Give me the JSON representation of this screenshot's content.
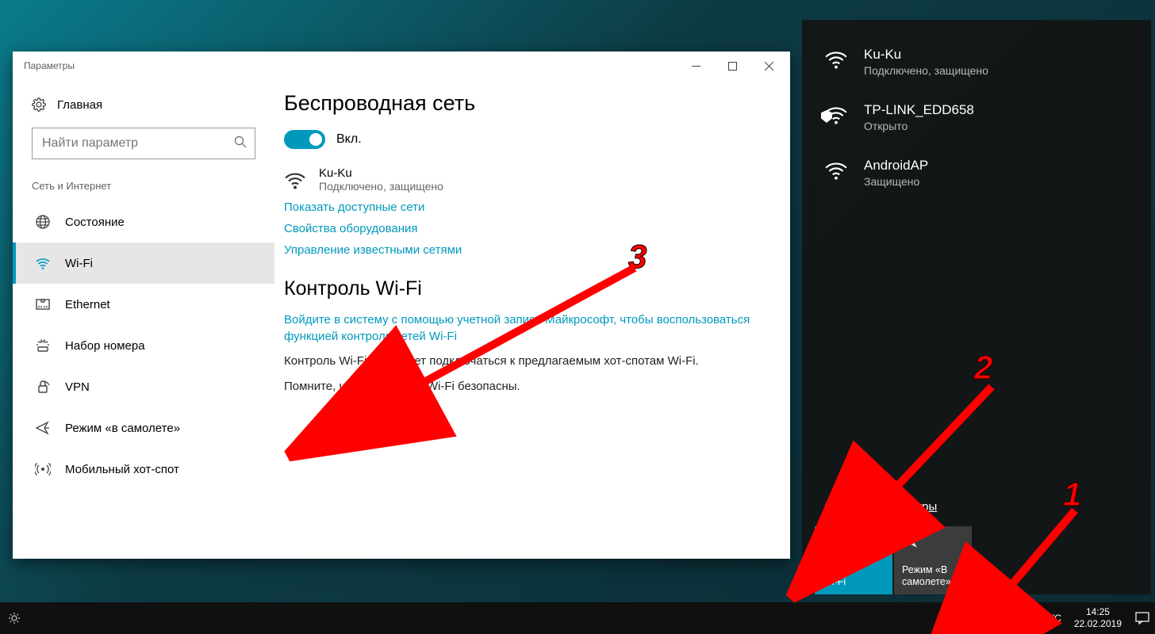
{
  "settings": {
    "title": "Параметры",
    "home": "Главная",
    "search_placeholder": "Найти параметр",
    "section": "Сеть и Интернет",
    "nav": [
      {
        "key": "status",
        "label": "Состояние"
      },
      {
        "key": "wifi",
        "label": "Wi-Fi"
      },
      {
        "key": "ethernet",
        "label": "Ethernet"
      },
      {
        "key": "dialup",
        "label": "Набор номера"
      },
      {
        "key": "vpn",
        "label": "VPN"
      },
      {
        "key": "airplane",
        "label": "Режим «в самолете»"
      },
      {
        "key": "hotspot",
        "label": "Мобильный хот-спот"
      }
    ],
    "content": {
      "h1": "Беспроводная сеть",
      "toggle_label": "Вкл.",
      "current_net": {
        "name": "Ku-Ku",
        "status": "Подключено, защищено"
      },
      "link_available": "Показать доступные сети",
      "link_hardware": "Свойства оборудования",
      "link_manage": "Управление известными сетями",
      "h2": "Контроль Wi-Fi",
      "link_signin": "Войдите в систему с помощью учетной записи Майкрософт, чтобы воспользоваться функцией контроля сетей Wi-Fi",
      "para1": "Контроль Wi-Fi позволяет подключаться к предлагаемым хот-спотам Wi-Fi.",
      "para2": "Помните, что не все сети Wi-Fi безопасны."
    }
  },
  "flyout": {
    "nets": [
      {
        "name": "Ku-Ku",
        "sub": "Подключено, защищено",
        "shield": false
      },
      {
        "name": "TP-LINK_EDD658",
        "sub": "Открыто",
        "shield": true
      },
      {
        "name": "AndroidAP",
        "sub": "Защищено",
        "shield": false
      }
    ],
    "settings_link": "Сетевые параметры",
    "tiles": {
      "wifi": "Wi-Fi",
      "airplane": "Режим «В самолете»"
    }
  },
  "taskbar": {
    "lang": "РУС",
    "time": "14:25",
    "date": "22.02.2019"
  },
  "annotations": {
    "n1": "1",
    "n2": "2",
    "n3": "3"
  }
}
